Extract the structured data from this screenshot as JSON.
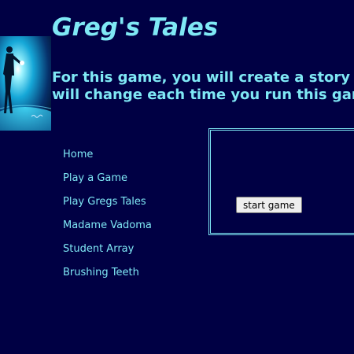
{
  "header": {
    "title": "Greg's Tales",
    "intro_line1": "For this game, you will create a story that",
    "intro_line2": "will change each time you run this game."
  },
  "hero_image": {
    "icon": "astronaut-figure-image"
  },
  "nav": {
    "items": [
      {
        "label": "Home"
      },
      {
        "label": "Play a Game"
      },
      {
        "label": "Play Gregs Tales"
      },
      {
        "label": "Madame Vadoma"
      },
      {
        "label": "Student Array"
      },
      {
        "label": "Brushing Teeth"
      }
    ]
  },
  "game": {
    "start_label": "start game"
  },
  "colors": {
    "background": "#000044",
    "accent": "#7fe8f5",
    "button_bg": "#eeeeee"
  }
}
